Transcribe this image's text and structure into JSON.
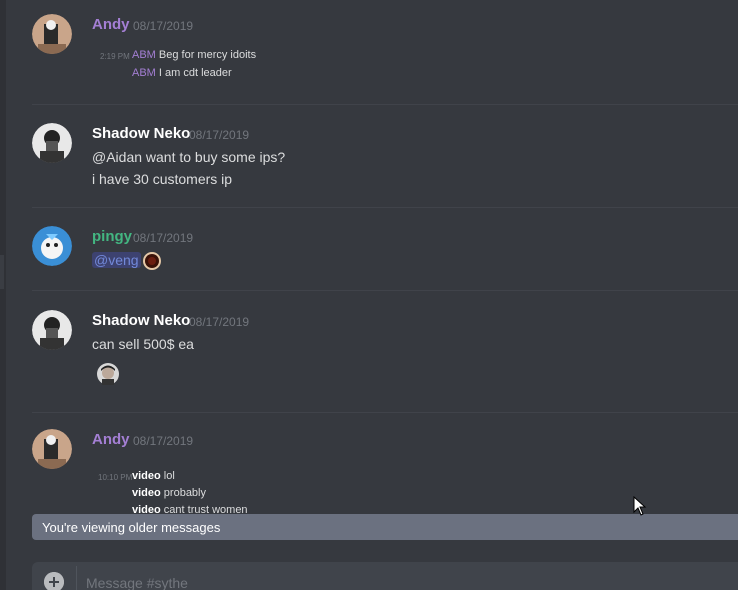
{
  "messages": [
    {
      "author": "Andy",
      "author_color": "#a47fd4",
      "timestamp": "08/17/2019",
      "small_time": "2:19 PM",
      "lines": [
        {
          "prefix": "ABM",
          "text": "Beg for mercy idoits"
        },
        {
          "prefix": "ABM",
          "text": "I am cdt leader"
        }
      ]
    },
    {
      "author": "Shadow Neko",
      "author_color": "#ffffff",
      "timestamp": "08/17/2019",
      "lines": [
        {
          "text": "@Aidan want to buy some ips?"
        },
        {
          "text": "i have 30 customers ip"
        }
      ]
    },
    {
      "author": "pingy",
      "author_color": "#43b581",
      "timestamp": "08/17/2019",
      "mention": "@veng"
    },
    {
      "author": "Shadow Neko",
      "author_color": "#ffffff",
      "timestamp": "08/17/2019",
      "lines": [
        {
          "text": "can sell 500$ ea"
        }
      ]
    },
    {
      "author": "Andy",
      "author_color": "#a47fd4",
      "timestamp": "08/17/2019",
      "small_time": "10:10 PM",
      "lines": [
        {
          "prefix": "video",
          "text": "lol"
        },
        {
          "prefix": "video",
          "text": "probably"
        },
        {
          "prefix": "video",
          "text": "cant trust women"
        }
      ]
    }
  ],
  "older_bar": "You're viewing older messages",
  "composer": {
    "placeholder": "Message #sythe"
  },
  "icons": {
    "plus": "plus-circle-icon",
    "cursor": "mouse-pointer-icon"
  }
}
